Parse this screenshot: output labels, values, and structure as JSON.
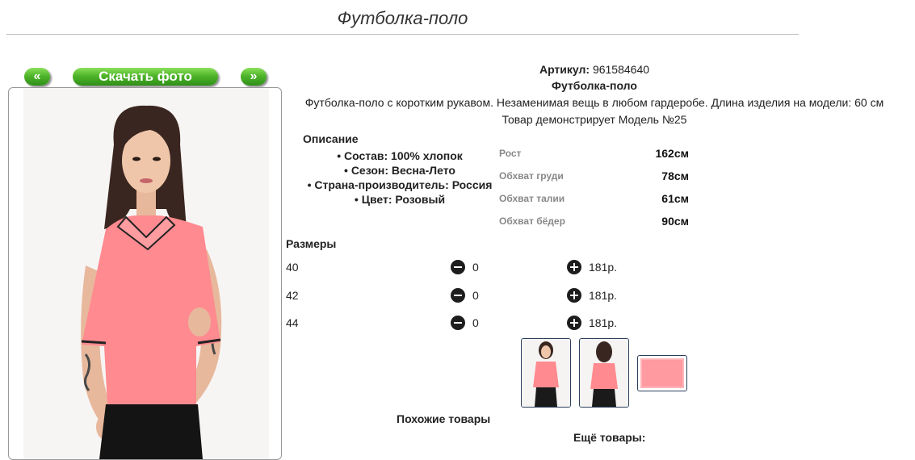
{
  "page": {
    "title": "Футболка-поло"
  },
  "nav": {
    "prev_label": "«",
    "download_label": "Скачать фото",
    "next_label": "»"
  },
  "product": {
    "article_label": "Артикул:",
    "article_value": "961584640",
    "name": "Футболка-поло",
    "description": "Футболка-поло с коротким рукавом. Незаменимая вещь в любом гардеробе. Длина изделия на модели: 60 см",
    "model_note": "Товар демонстрирует Модель №25"
  },
  "description_section": {
    "title": "Описание",
    "features": [
      "• Состав: 100% хлопок",
      "• Сезон: Весна-Лето",
      "• Страна-производитель: Россия",
      "• Цвет: Розовый"
    ]
  },
  "measurements": [
    {
      "label": "Рост",
      "value": "162см"
    },
    {
      "label": "Обхват груди",
      "value": "78см"
    },
    {
      "label": "Обхват талии",
      "value": "61см"
    },
    {
      "label": "Обхват бёдер",
      "value": "90см"
    }
  ],
  "sizes": {
    "title": "Размеры",
    "rows": [
      {
        "size": "40",
        "qty": "0",
        "price": "181р."
      },
      {
        "size": "42",
        "qty": "0",
        "price": "181р."
      },
      {
        "size": "44",
        "qty": "0",
        "price": "181р."
      }
    ]
  },
  "footer": {
    "similar_title": "Похожие товары",
    "more_title": "Ещё товары:"
  },
  "colors": {
    "button_green": "#4fb52a",
    "shirt_pink": "#ff8a8f",
    "thumb_border": "#2b3f5c"
  },
  "icons": {
    "minus": "minus-circle-icon",
    "plus": "plus-circle-icon"
  }
}
